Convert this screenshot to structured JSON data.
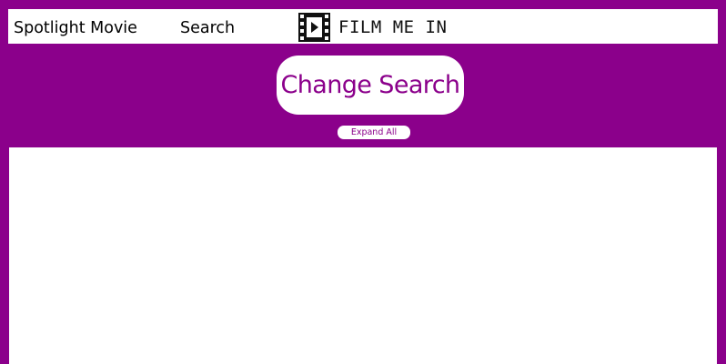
{
  "nav": {
    "spotlight_label": "Spotlight Movie",
    "search_label": "Search",
    "logo_text": "FILM ME IN",
    "logo_icon": "film-play-icon"
  },
  "actions": {
    "change_search_label": "Change Search",
    "expand_all_label": "Expand All"
  },
  "colors": {
    "background": "#8b008b",
    "accent_text": "#8b008b",
    "panel": "#ffffff"
  }
}
